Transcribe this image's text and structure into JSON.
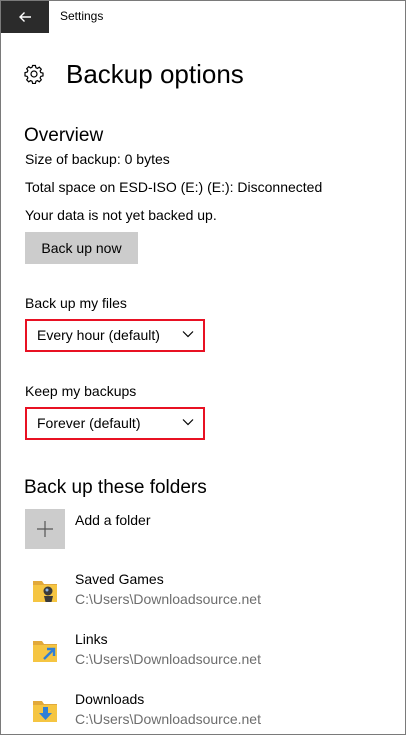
{
  "window": {
    "title": "Settings"
  },
  "page": {
    "title": "Backup options"
  },
  "overview": {
    "heading": "Overview",
    "size_text": "Size of backup: 0 bytes",
    "space_text": "Total space on ESD-ISO (E:) (E:): Disconnected",
    "status_text": "Your data is not yet backed up.",
    "backup_button": "Back up now"
  },
  "frequency": {
    "label": "Back up my files",
    "value": "Every hour (default)"
  },
  "retention": {
    "label": "Keep my backups",
    "value": "Forever (default)"
  },
  "folders": {
    "heading": "Back up these folders",
    "add_label": "Add a folder",
    "items": [
      {
        "name": "Saved Games",
        "path": "C:\\Users\\Downloadsource.net",
        "icon": "saved-games-folder-icon"
      },
      {
        "name": "Links",
        "path": "C:\\Users\\Downloadsource.net",
        "icon": "links-folder-icon"
      },
      {
        "name": "Downloads",
        "path": "C:\\Users\\Downloadsource.net",
        "icon": "downloads-folder-icon"
      }
    ]
  },
  "colors": {
    "highlight_border": "#e81123",
    "back_button_bg": "#2b2b2b",
    "button_bg": "#cccccc",
    "secondary_text": "#6d6d6d",
    "folder_yellow": "#f5c542"
  }
}
